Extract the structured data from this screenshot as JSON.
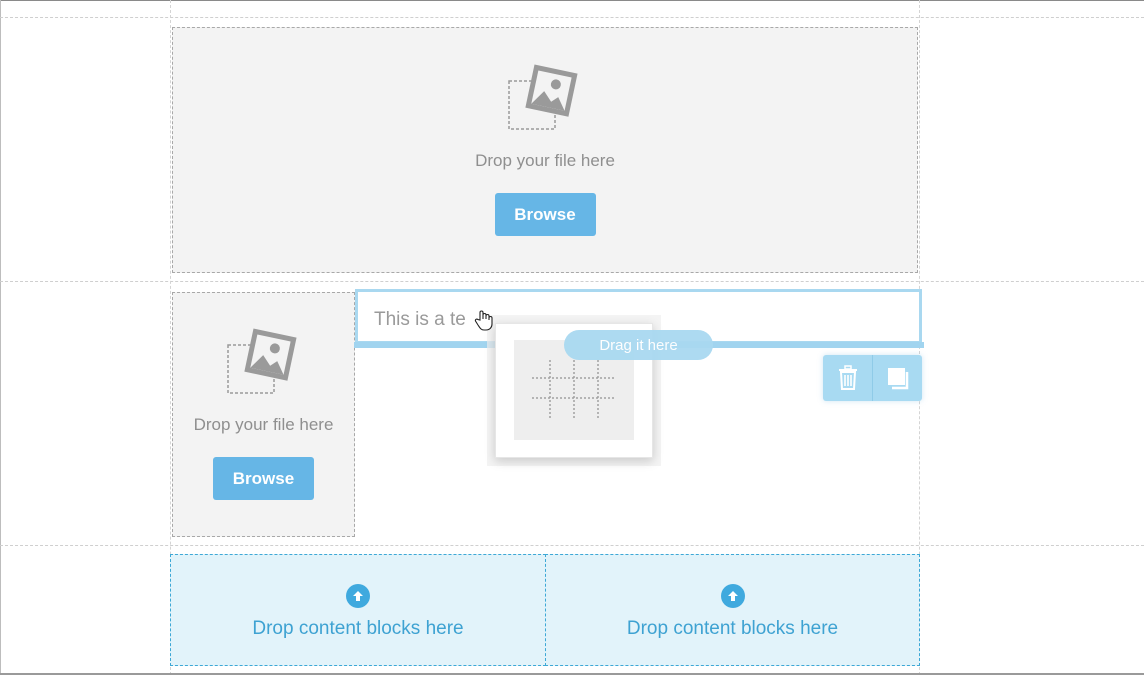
{
  "top_image_block": {
    "drop_text": "Drop your file here",
    "browse_label": "Browse",
    "icon": "image-placeholder-icon"
  },
  "left_image_block": {
    "drop_text": "Drop your file here",
    "browse_label": "Browse",
    "icon": "image-placeholder-icon"
  },
  "text_block": {
    "text": "This is a te",
    "drop_hint": "Drag it here"
  },
  "toolbar": {
    "delete_icon": "trash-icon",
    "duplicate_icon": "duplicate-icon"
  },
  "dragged_block": {
    "icon": "table-grid-icon"
  },
  "bottom_drop": {
    "left_text": "Drop content blocks here",
    "right_text": "Drop content blocks here",
    "icon": "arrow-up-circle-icon"
  },
  "colors": {
    "accent": "#66b6e6",
    "drop_bg": "#e2f3fa",
    "drop_text": "#3ea2d2",
    "zone_bg": "#f3f3f3"
  }
}
